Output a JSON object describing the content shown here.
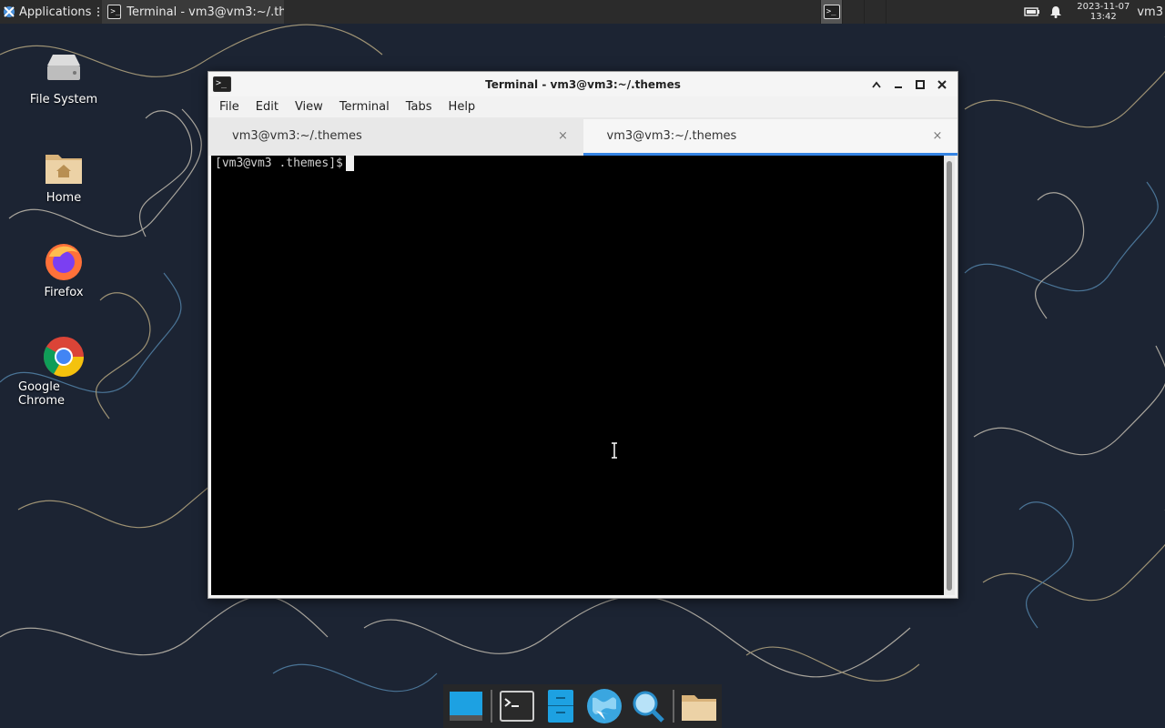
{
  "panel": {
    "apps_label": "Applications",
    "task_title": "Terminal - vm3@vm3:~/.th...",
    "clock_date": "2023-11-07",
    "clock_time": "13:42",
    "user": "vm3"
  },
  "desktop": {
    "icons": [
      {
        "label": "File System"
      },
      {
        "label": "Home"
      },
      {
        "label": "Firefox"
      },
      {
        "label": "Google Chrome"
      }
    ]
  },
  "terminal": {
    "title": "Terminal - vm3@vm3:~/.themes",
    "menu": [
      "File",
      "Edit",
      "View",
      "Terminal",
      "Tabs",
      "Help"
    ],
    "tabs": [
      {
        "label": "vm3@vm3:~/.themes",
        "close": "×"
      },
      {
        "label": "vm3@vm3:~/.themes",
        "close": "×"
      }
    ],
    "prompt": "[vm3@vm3 .themes]$"
  },
  "colors": {
    "tab_active_accent": "#3584e4",
    "panel_bg": "#2b2b2b",
    "wallpaper_bg": "#1c2433"
  },
  "icons": {
    "window_minimize": "minimize-icon",
    "window_maximize": "maximize-icon",
    "window_close": "close-icon",
    "window_shade": "shade-icon"
  }
}
